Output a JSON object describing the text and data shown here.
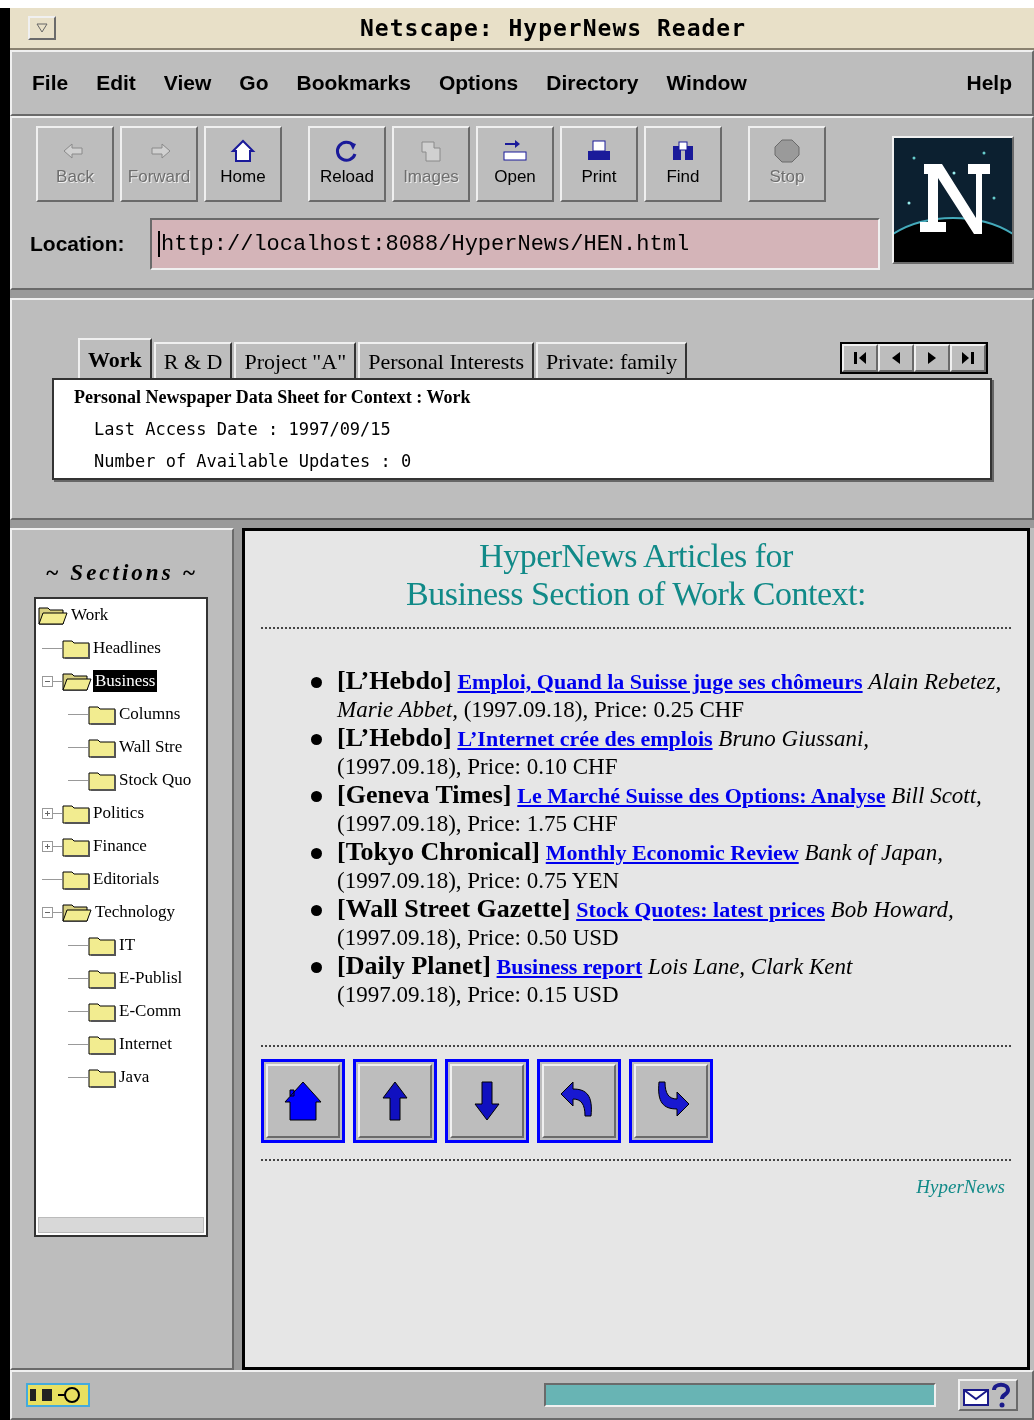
{
  "window": {
    "title": "Netscape: HyperNews Reader"
  },
  "menu": [
    "File",
    "Edit",
    "View",
    "Go",
    "Bookmarks",
    "Options",
    "Directory",
    "Window"
  ],
  "help_menu": "Help",
  "toolbar": [
    {
      "label": "Back",
      "kind": "back",
      "disabled": true
    },
    {
      "label": "Forward",
      "kind": "forward",
      "disabled": true
    },
    {
      "label": "Home",
      "kind": "home",
      "disabled": false
    },
    {
      "label": "Reload",
      "kind": "reload",
      "disabled": false
    },
    {
      "label": "Images",
      "kind": "images",
      "disabled": true
    },
    {
      "label": "Open",
      "kind": "open",
      "disabled": false
    },
    {
      "label": "Print",
      "kind": "print",
      "disabled": false
    },
    {
      "label": "Find",
      "kind": "find",
      "disabled": false
    },
    {
      "label": "Stop",
      "kind": "stop",
      "disabled": true
    }
  ],
  "location": {
    "label": "Location:",
    "value": "http://localhost:8088/HyperNews/HEN.html"
  },
  "tabs": [
    {
      "label": "Work",
      "selected": true
    },
    {
      "label": "R & D",
      "selected": false
    },
    {
      "label": "Project \"A\"",
      "selected": false
    },
    {
      "label": "Personal Interests",
      "selected": false
    },
    {
      "label": "Private: family",
      "selected": false
    }
  ],
  "data_sheet": {
    "title": "Personal Newspaper Data Sheet for Context : Work",
    "lines": [
      "Last Access Date : 1997/09/15",
      "Number of Available Updates : 0"
    ]
  },
  "sections": {
    "title": "~ Sections ~",
    "tree": [
      {
        "label": "Work",
        "selected": false,
        "expanded": true,
        "children": [
          {
            "label": "Headlines",
            "selected": false
          },
          {
            "label": "Business",
            "selected": true,
            "expanded": true,
            "children": [
              {
                "label": "Columns",
                "selected": false
              },
              {
                "label": "Wall Stre",
                "selected": false
              },
              {
                "label": "Stock Quo",
                "selected": false
              }
            ]
          },
          {
            "label": "Politics",
            "selected": false,
            "expanded": false
          },
          {
            "label": "Finance",
            "selected": false,
            "expanded": false
          },
          {
            "label": "Editorials",
            "selected": false
          },
          {
            "label": "Technology",
            "selected": false,
            "expanded": true,
            "children": [
              {
                "label": "IT",
                "selected": false
              },
              {
                "label": "E-Publisl",
                "selected": false
              },
              {
                "label": "E-Comm",
                "selected": false
              },
              {
                "label": "Internet",
                "selected": false
              },
              {
                "label": "Java",
                "selected": false
              }
            ]
          }
        ]
      }
    ]
  },
  "content": {
    "heading": [
      "HyperNews Articles for",
      "Business Section of Work Context:"
    ],
    "articles": [
      {
        "source": "[L’Hebdo]",
        "title": "Emploi, Quand la Suisse juge ses chômeurs",
        "authors": "Alain Rebetez, Marie Abbet,",
        "details": "(1997.09.18), Price: 0.25 CHF"
      },
      {
        "source": "[L’Hebdo]",
        "title": "L’Internet crée des emplois",
        "authors": "Bruno Giussani,",
        "details": "(1997.09.18), Price: 0.10 CHF"
      },
      {
        "source": "[Geneva Times]",
        "title": "Le Marché Suisse des Options: Analyse",
        "authors": "Bill Scott,",
        "details": "(1997.09.18), Price: 1.75 CHF"
      },
      {
        "source": "[Tokyo Chronical]",
        "title": "Monthly Economic Review",
        "authors": "Bank of Japan,",
        "details": "(1997.09.18), Price: 0.75 YEN"
      },
      {
        "source": "[Wall Street Gazette]",
        "title": "Stock Quotes: latest prices",
        "authors": "Bob Howard,",
        "details": "(1997.09.18), Price: 0.50 USD"
      },
      {
        "source": "[Daily Planet]",
        "title": "Business report",
        "authors": "Lois Lane, Clark Kent",
        "details": "(1997.09.18), Price: 0.15 USD"
      }
    ],
    "footer": "HyperNews"
  },
  "status_bar": {
    "progress": {
      "level": 1
    }
  }
}
